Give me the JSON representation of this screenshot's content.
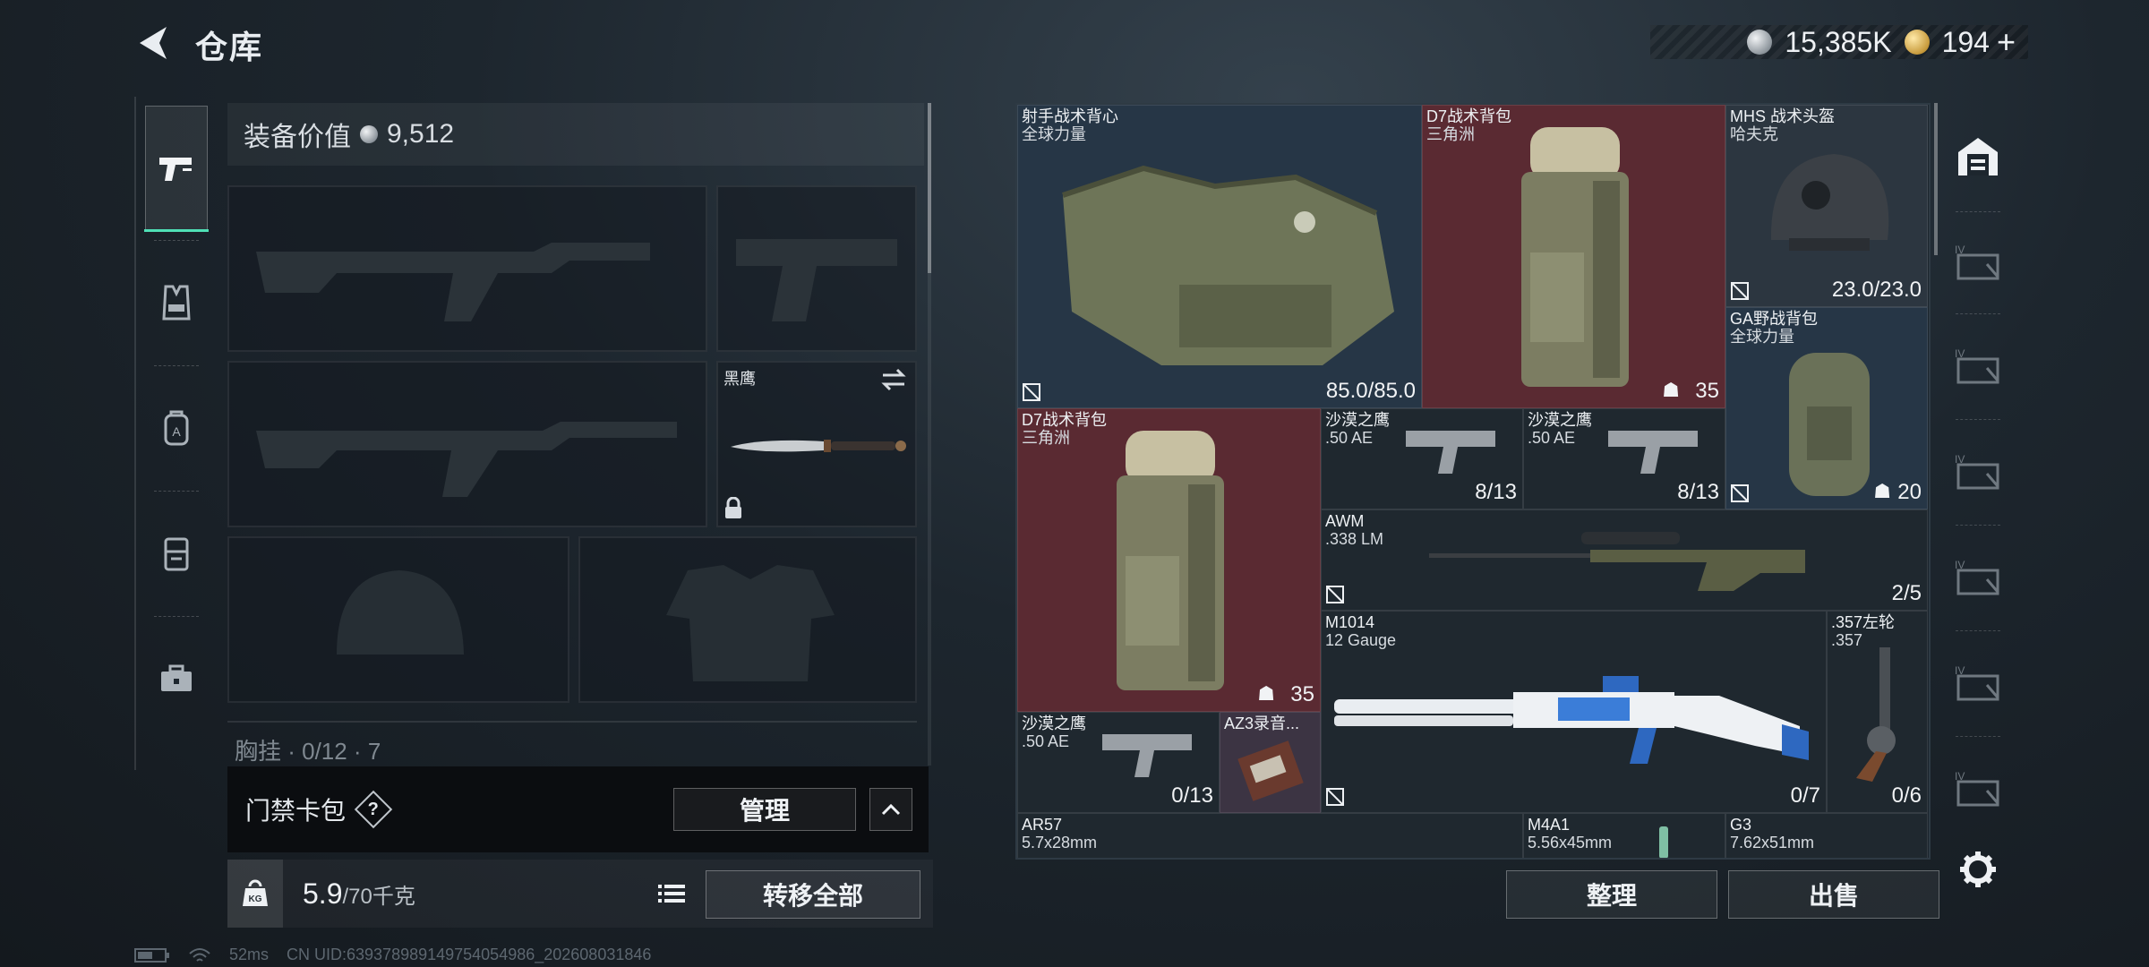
{
  "header": {
    "title": "仓库",
    "currency_silver": "15,385K",
    "currency_gold": "194",
    "currency_add": "+"
  },
  "left_tabs": [
    "pistol",
    "vest",
    "backpack",
    "case",
    "toolbox"
  ],
  "equipment": {
    "value_label": "装备价值",
    "value": "9,512",
    "melee_slot_name": "黑鹰",
    "chest_rig_text": "胸挂 · 0/12 · 7"
  },
  "keycard": {
    "label": "门禁卡包",
    "help": "?",
    "manage_label": "管理"
  },
  "weight": {
    "current": "5.9",
    "max": "/70千克"
  },
  "transfer_all_label": "转移全部",
  "storage": {
    "items": [
      {
        "name": "射手战术背心",
        "sub": "全球力量",
        "count": "85.0/85.0",
        "color": "blue",
        "bound": true
      },
      {
        "name": "D7战术背包",
        "sub": "三角洲",
        "count": "35",
        "color": "red",
        "ghost": true
      },
      {
        "name": "MHS 战术头盔",
        "sub": "哈夫克",
        "count": "23.0/23.0",
        "color": "gray",
        "bound": true
      },
      {
        "name": "GA野战背包",
        "sub": "全球力量",
        "count": "20",
        "color": "blue",
        "bound": true,
        "ghost": true
      },
      {
        "name": "D7战术背包",
        "sub": "三角洲",
        "count": "35",
        "color": "red",
        "ghost": true
      },
      {
        "name": "沙漠之鹰",
        "sub": ".50 AE",
        "count": "8/13",
        "color": "dark"
      },
      {
        "name": "沙漠之鹰",
        "sub": ".50 AE",
        "count": "8/13",
        "color": "dark"
      },
      {
        "name": "AWM",
        "sub": ".338 LM",
        "count": "2/5",
        "color": "dark",
        "bound": true
      },
      {
        "name": "M1014",
        "sub": "12 Gauge",
        "count": "0/7",
        "color": "dark",
        "bound": true
      },
      {
        "name": ".357左轮",
        "sub": ".357",
        "count": "0/6",
        "color": "dark"
      },
      {
        "name": "沙漠之鹰",
        "sub": ".50 AE",
        "count": "0/13",
        "color": "dark"
      },
      {
        "name": "AZ3录音...",
        "sub": "",
        "count": "",
        "color": "purple"
      },
      {
        "name": "AR57",
        "sub": "5.7x28mm",
        "count": "",
        "color": "dark"
      },
      {
        "name": "M4A1",
        "sub": "5.56x45mm",
        "count": "",
        "color": "dark"
      },
      {
        "name": "G3",
        "sub": "7.62x51mm",
        "count": "",
        "color": "dark"
      }
    ]
  },
  "actions": {
    "sort_label": "整理",
    "sell_label": "出售"
  },
  "right_column": {
    "tier_label": "IV"
  },
  "status": {
    "ping": "52ms",
    "uid": "CN UID:6393789891497540549​86_202608031846"
  },
  "colors": {
    "accent": "#4fe0b6",
    "red_slot": "#5a2a32",
    "blue_slot": "#263646",
    "purple_slot": "#3c3443"
  }
}
